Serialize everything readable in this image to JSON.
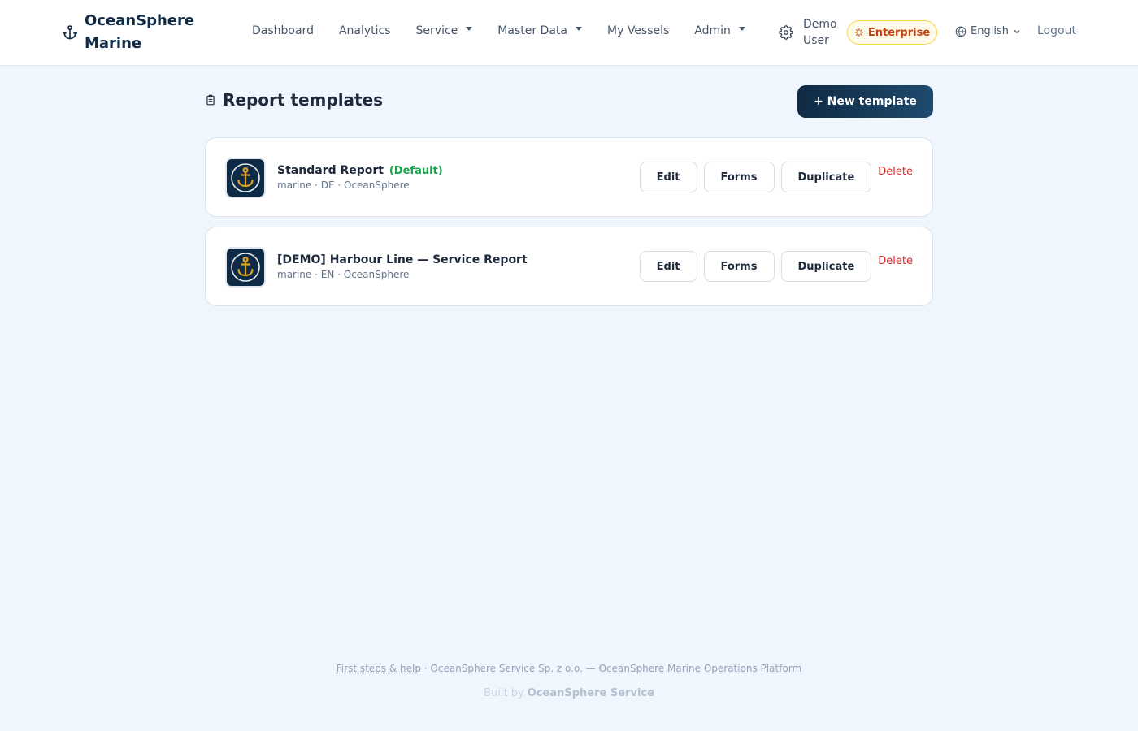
{
  "brand": {
    "line1": "OceanSphere",
    "line2": "Marine",
    "icon": "anchor-icon"
  },
  "nav": {
    "items": [
      {
        "label": "Dashboard",
        "dropdown": false
      },
      {
        "label": "Analytics",
        "dropdown": false
      },
      {
        "label": "Service",
        "dropdown": true
      },
      {
        "label": "Master Data",
        "dropdown": true
      },
      {
        "label": "My Vessels",
        "dropdown": false
      },
      {
        "label": "Admin",
        "dropdown": true
      }
    ],
    "user_line1": "Demo",
    "user_line2": "User",
    "plan_badge": "Enterprise",
    "language": "English",
    "logout": "Logout"
  },
  "page": {
    "title": "Report templates",
    "new_button": "+ New template"
  },
  "templates": [
    {
      "name": "Standard Report",
      "default_label": "(Default)",
      "meta": "marine · DE · OceanSphere",
      "actions": {
        "edit": "Edit",
        "forms": "Forms",
        "duplicate": "Duplicate",
        "delete": "Delete"
      }
    },
    {
      "name": "[DEMO] Harbour Line — Service Report",
      "default_label": "",
      "meta": "marine · EN · OceanSphere",
      "actions": {
        "edit": "Edit",
        "forms": "Forms",
        "duplicate": "Duplicate",
        "delete": "Delete"
      }
    }
  ],
  "footer": {
    "help_link": "First steps & help",
    "company": " · OceanSphere Service Sp. z o.o. — OceanSphere Marine Operations Platform",
    "built_prefix": "Built by ",
    "built_name": "OceanSphere Service"
  },
  "colors": {
    "brand_navy": "#0f2a44",
    "accent_gold": "#e0a526",
    "default_green": "#16a34a",
    "delete_red": "#dc2626",
    "badge_orange": "#c2410c"
  }
}
